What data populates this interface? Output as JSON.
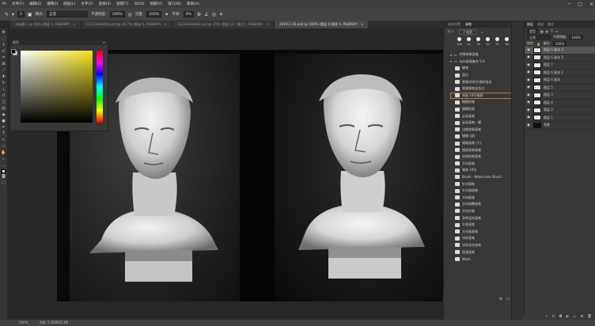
{
  "menu": [
    "文件(F)",
    "编辑(E)",
    "图像(I)",
    "图层(L)",
    "文字(Y)",
    "选择(S)",
    "滤镜(T)",
    "3D(D)",
    "视图(V)",
    "窗口(W)",
    "帮助(H)"
  ],
  "options": {
    "mode_label": "模式:",
    "mode_value": "正常",
    "opacity_label": "不透明度:",
    "opacity_value": "100%",
    "flow_label": "流量:",
    "flow_value": "100%",
    "smooth_label": "平滑:",
    "smooth_value": "0%",
    "brush_size": "1"
  },
  "tabs": [
    {
      "label": "未标题-1 @ 50% (图层 1, RGB/8#)",
      "active": false
    },
    {
      "label": "11223344444.psd @ 16.7% (图层 5, RGB/8#)",
      "active": false
    },
    {
      "label": "11223344442.psd @ 25% (图层 11 ( 备注 ), RGB/8#)",
      "active": false
    },
    {
      "label": "2019.2.16.psd @ 100% (图层 6 副本 4, RGB/8#)",
      "active": true
    }
  ],
  "color_panel": {
    "title": "颜色"
  },
  "brush_panel": {
    "tabs": [
      "画笔设置",
      "画笔"
    ],
    "size_label": "大小:",
    "size_value": "7 像素",
    "presets": [
      "158",
      "24",
      "36",
      "20",
      "25",
      "36"
    ],
    "items": [
      {
        "label": "特殊效果画笔",
        "type": "group"
      },
      {
        "label": "kyle画笔集合 5.0",
        "type": "group"
      },
      {
        "label": "硬笔",
        "type": "sub"
      },
      {
        "label": "混边",
        "type": "sub"
      },
      {
        "label": "钢笔(好的不透明混合",
        "type": "sub"
      },
      {
        "label": "钢笔钢笔混合边",
        "type": "sub"
      },
      {
        "label": "刻画 19号笔刷",
        "type": "sub",
        "hl": true
      },
      {
        "label": "精细铅笔",
        "type": "sub"
      },
      {
        "label": "模糊铅笔",
        "type": "sub"
      },
      {
        "label": "云朵画笔",
        "type": "sub"
      },
      {
        "label": "云朵画笔 - 硬",
        "type": "sub"
      },
      {
        "label": "边缘效果画笔",
        "type": "sub"
      },
      {
        "label": "蜡笔 (湿)",
        "type": "sub"
      },
      {
        "label": "蜡笔画笔 (干)",
        "type": "sub"
      },
      {
        "label": "图纸效果画笔",
        "type": "sub"
      },
      {
        "label": "纹理效果画笔",
        "type": "sub"
      },
      {
        "label": "方块画笔",
        "type": "sub"
      },
      {
        "label": "笔刷 19号",
        "type": "sub"
      },
      {
        "label": "Brush - Watercolor Brush",
        "type": "sub"
      },
      {
        "label": "针对调笔",
        "type": "sub"
      },
      {
        "label": "针对调画笔",
        "type": "sub"
      },
      {
        "label": "方块画笔",
        "type": "sub"
      },
      {
        "label": "方块调整画笔",
        "type": "sub"
      },
      {
        "label": "方块内笔",
        "type": "sub"
      },
      {
        "label": "多种混合画笔",
        "type": "sub"
      },
      {
        "label": "针笔画笔",
        "type": "sub"
      },
      {
        "label": "方块画画笔",
        "type": "sub"
      },
      {
        "label": "块状画笔",
        "type": "sub"
      },
      {
        "label": "块状混合画笔",
        "type": "sub"
      },
      {
        "label": "快速画笔",
        "type": "sub"
      },
      {
        "label": "Wash",
        "type": "sub"
      }
    ]
  },
  "layers_panel": {
    "tabs": [
      "图层",
      "通道",
      "路径"
    ],
    "kind_label": "类型",
    "blend_value": "正常",
    "opacity_label": "不透明度:",
    "opacity_value": "100%",
    "lock_label": "锁定:",
    "fill_label": "填充:",
    "fill_value": "100%",
    "layers": [
      {
        "name": "图层 6 副本 4",
        "sel": true,
        "thumb": "checker"
      },
      {
        "name": "图层 6 副本 3",
        "sel": false,
        "thumb": "checker"
      },
      {
        "name": "图层 7",
        "sel": false,
        "thumb": "checker"
      },
      {
        "name": "图层 6 副本 2",
        "sel": false,
        "thumb": "checker"
      },
      {
        "name": "图层 6 副本",
        "sel": false,
        "thumb": "checker"
      },
      {
        "name": "图层 5",
        "sel": false,
        "thumb": "checker"
      },
      {
        "name": "图层 3",
        "sel": false,
        "thumb": "checker"
      },
      {
        "name": "图层 4",
        "sel": false,
        "thumb": "checker"
      },
      {
        "name": "图层 2",
        "sel": false,
        "thumb": "checker"
      },
      {
        "name": "图层 1",
        "sel": false,
        "thumb": "checker"
      },
      {
        "name": "背景",
        "sel": false,
        "thumb": "dark"
      }
    ]
  },
  "status": {
    "zoom": "100%",
    "doc": "文档: 2.31M/22.4M"
  }
}
